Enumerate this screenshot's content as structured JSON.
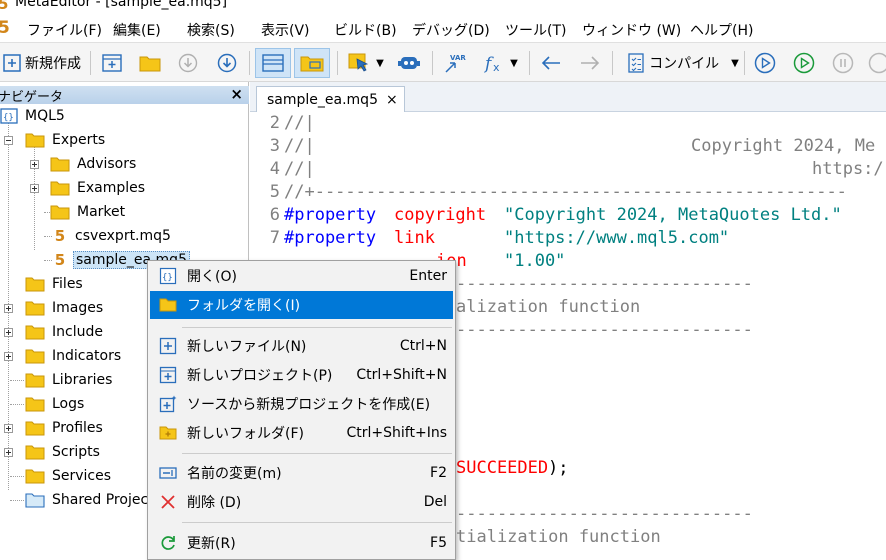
{
  "window": {
    "title": "MetaEditor - [sample_ea.mq5]"
  },
  "menubar": {
    "items": [
      "ファイル(F)",
      "編集(E)",
      "検索(S)",
      "表示(V)",
      "ビルド(B)",
      "デバッグ(D)",
      "ツール(T)",
      "ウィンドウ (W)",
      "ヘルプ(H)"
    ]
  },
  "toolbar": {
    "new_label": "新規作成",
    "compile_label": "コンパイル"
  },
  "navigator": {
    "title": "ナビゲータ",
    "close": "×",
    "root": "MQL5",
    "experts": "Experts",
    "advisors": "Advisors",
    "examples": "Examples",
    "market": "Market",
    "file1": "csvexprt.mq5",
    "file2": "sample_ea.mq5",
    "file_icon": "5",
    "folders": [
      "Files",
      "Images",
      "Include",
      "Indicators",
      "Libraries",
      "Logs",
      "Profiles",
      "Scripts",
      "Services",
      "Shared Projects"
    ]
  },
  "editor": {
    "tab_label": "sample_ea.mq5",
    "tab_close": "×",
    "line_numbers": [
      "2",
      "3",
      "4",
      "5",
      "6",
      "7"
    ],
    "line2": "//|",
    "line3_a": "//|",
    "line3_b": "Copyright 2024, Me",
    "line4_a": "//|",
    "line4_b": "https:/",
    "line5": "//+----------------------------------------------------",
    "line6_a": "#property",
    "line6_b": "copyright",
    "line6_c": "\"Copyright 2024, MetaQuotes Ltd.\"",
    "line7_a": "#property",
    "line7_b": "link",
    "line7_c": "\"https://www.mql5.com\"",
    "line8_b": "ion",
    "line8_c": "\"1.00\"",
    "frag_dash1": "-----------------------------",
    "frag_init": "alization function",
    "frag_dash2": "-----------------------------",
    "frag_succ_a": "SUCCEEDED",
    "frag_succ_b": ");",
    "frag_dash3": "-----------------------------",
    "frag_deinit": "tialization function"
  },
  "context_menu": {
    "items": [
      {
        "label": "開く(O)",
        "shortcut": "Enter"
      },
      {
        "label": "フォルダを開く(I)",
        "shortcut": ""
      },
      {
        "label": "新しいファイル(N)",
        "shortcut": "Ctrl+N"
      },
      {
        "label": "新しいプロジェクト(P)",
        "shortcut": "Ctrl+Shift+N"
      },
      {
        "label": "ソースから新規プロジェクトを作成(E)",
        "shortcut": ""
      },
      {
        "label": "新しいフォルダ(F)",
        "shortcut": "Ctrl+Shift+Ins"
      },
      {
        "label": "名前の変更(m)",
        "shortcut": "F2"
      },
      {
        "label": "削除 (D)",
        "shortcut": "Del"
      },
      {
        "label": "更新(R)",
        "shortcut": "F5"
      }
    ]
  },
  "colors": {
    "accent": "#0078d7",
    "folder": "#f5c518",
    "mq5_icon": "#d2861a"
  }
}
